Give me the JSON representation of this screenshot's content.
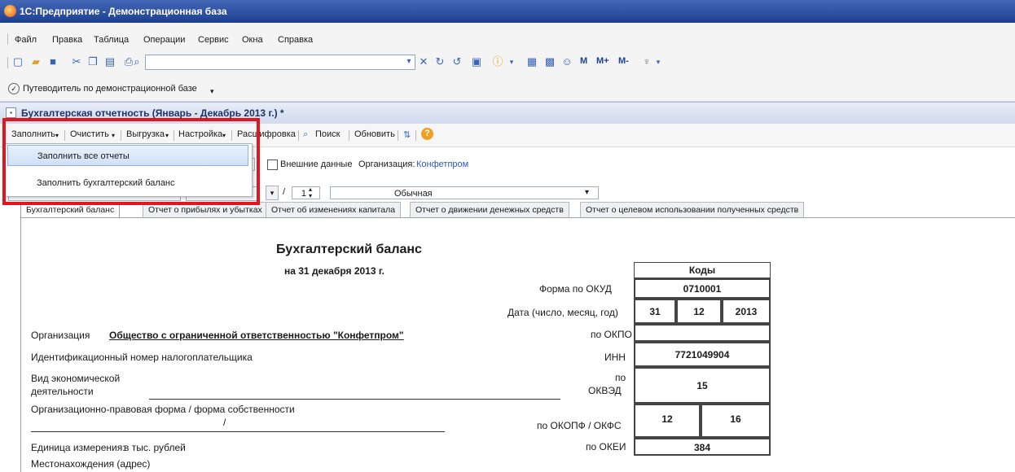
{
  "window": {
    "title": "1С:Предприятие - Демонстрационная база"
  },
  "menu": [
    "Файл",
    "Правка",
    "Таблица",
    "Операции",
    "Сервис",
    "Окна",
    "Справка"
  ],
  "toolbar": {
    "search_value": "",
    "m_buttons": [
      "M",
      "M+",
      "M-"
    ]
  },
  "guide": {
    "label": "Путеводитель по демонстрационной базе"
  },
  "document": {
    "title": "Бухгалтерская отчетность (Январь - Декабрь 2013 г.) *"
  },
  "commands": [
    "Заполнить",
    "Очистить",
    "Выгрузка",
    "Настройка",
    "Расшифровка",
    "Поиск",
    "Обновить"
  ],
  "dropdown": {
    "items": [
      "Заполнить все отчеты",
      "Заполнить бухгалтерский баланс"
    ]
  },
  "params": {
    "external_data_label": "Внешние данные",
    "organization_label": "Организация:",
    "organization_value": "Конфетпром",
    "slash": "/",
    "counter_value": "1",
    "mode_value": "Обычная"
  },
  "tabs": [
    "Бухгалтерский баланс",
    "Отчет о прибылях и убытках",
    "Отчет об изменениях капитала",
    "Отчет о движении денежных средств",
    "Отчет о целевом использовании полученных средств"
  ],
  "form": {
    "heading": "Бухгалтерский баланс",
    "date_line": "на 31 декабря 2013 г.",
    "codes_header": "Коды",
    "okud_label": "Форма по ОКУД",
    "okud_value": "0710001",
    "date_label": "Дата (число, месяц, год)",
    "date_day": "31",
    "date_month": "12",
    "date_year": "2013",
    "org_label": "Организация",
    "org_value": "Общество с ограниченной ответственностью \"Конфетпром\"",
    "okpo_label": "по ОКПО",
    "okpo_value": "",
    "inn_row_label": "Идентификационный номер налогоплательщика",
    "inn_label": "ИНН",
    "inn_value": "7721049904",
    "activity_label_1": "Вид экономической",
    "activity_label_2": "деятельности",
    "okved_label_1": "по",
    "okved_label_2": "ОКВЭД",
    "okved_value": "15",
    "legal_form_label": "Организационно-правовая форма / форма собственности",
    "legal_form_slash": "/",
    "okopf_label": "по ОКОПФ / ОКФС",
    "okopf_value": "12",
    "okfs_value": "16",
    "unit_label": "Единица измерения:",
    "unit_value": "в тыс. рублей",
    "okei_label": "по ОКЕИ",
    "okei_value": "384",
    "location_label": "Местонахождения (адрес)"
  },
  "colors": {
    "highlight_box": "#e0171d",
    "title_bar": "#2a4b9b",
    "link": "#2f57c0"
  }
}
